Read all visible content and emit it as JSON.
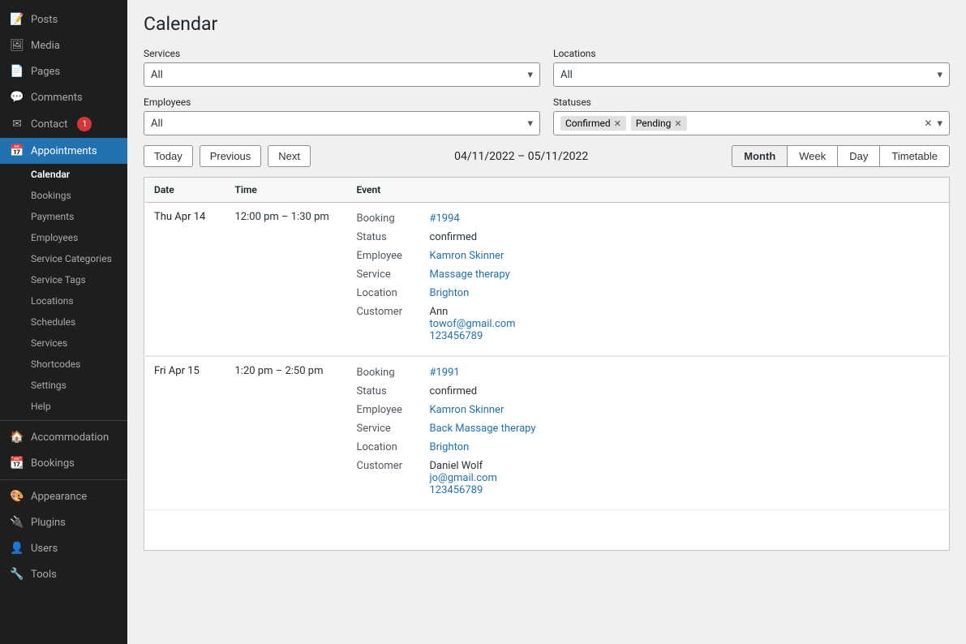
{
  "sidebar": {
    "items": [
      {
        "id": "posts",
        "icon": "📝",
        "label": "Posts"
      },
      {
        "id": "media",
        "icon": "🖼",
        "label": "Media"
      },
      {
        "id": "pages",
        "icon": "📄",
        "label": "Pages"
      },
      {
        "id": "comments",
        "icon": "💬",
        "label": "Comments"
      },
      {
        "id": "contact",
        "icon": "✉",
        "label": "Contact",
        "badge": "1"
      },
      {
        "id": "appointments",
        "icon": "📅",
        "label": "Appointments",
        "active": true
      }
    ],
    "appointments_sub": [
      {
        "id": "calendar",
        "label": "Calendar",
        "active": true
      },
      {
        "id": "bookings",
        "label": "Bookings"
      },
      {
        "id": "payments",
        "label": "Payments"
      },
      {
        "id": "employees",
        "label": "Employees"
      },
      {
        "id": "service-categories",
        "label": "Service Categories"
      },
      {
        "id": "service-tags",
        "label": "Service Tags"
      },
      {
        "id": "locations",
        "label": "Locations"
      },
      {
        "id": "schedules",
        "label": "Schedules"
      },
      {
        "id": "services",
        "label": "Services"
      },
      {
        "id": "shortcodes",
        "label": "Shortcodes"
      },
      {
        "id": "settings",
        "label": "Settings"
      },
      {
        "id": "help",
        "label": "Help"
      }
    ],
    "bottom_items": [
      {
        "id": "accommodation",
        "icon": "🏠",
        "label": "Accommodation"
      },
      {
        "id": "bookings2",
        "icon": "📆",
        "label": "Bookings"
      },
      {
        "id": "appearance",
        "icon": "🎨",
        "label": "Appearance"
      },
      {
        "id": "plugins",
        "icon": "🔌",
        "label": "Plugins"
      },
      {
        "id": "users",
        "icon": "👤",
        "label": "Users"
      },
      {
        "id": "tools",
        "icon": "🔧",
        "label": "Tools"
      }
    ]
  },
  "page": {
    "title": "Calendar"
  },
  "filters": {
    "services_label": "Services",
    "services_value": "All",
    "locations_label": "Locations",
    "locations_value": "All",
    "employees_label": "Employees",
    "employees_value": "All",
    "statuses_label": "Statuses",
    "statuses_tags": [
      {
        "label": "Confirmed"
      },
      {
        "label": "Pending"
      }
    ]
  },
  "navigation": {
    "today_label": "Today",
    "previous_label": "Previous",
    "next_label": "Next",
    "date_range": "04/11/2022 – 05/11/2022",
    "views": [
      {
        "id": "month",
        "label": "Month",
        "active": true
      },
      {
        "id": "week",
        "label": "Week"
      },
      {
        "id": "day",
        "label": "Day"
      },
      {
        "id": "timetable",
        "label": "Timetable"
      }
    ]
  },
  "table": {
    "headers": [
      {
        "id": "date",
        "label": "Date"
      },
      {
        "id": "time",
        "label": "Time"
      },
      {
        "id": "event",
        "label": "Event"
      }
    ],
    "rows": [
      {
        "date": "Thu Apr 14",
        "time": "12:00 pm – 1:30 pm",
        "booking_label": "Booking",
        "booking_value": "#1994",
        "booking_link": "#",
        "status_label": "Status",
        "status_value": "confirmed",
        "employee_label": "Employee",
        "employee_value": "Kamron Skinner",
        "employee_link": "#",
        "service_label": "Service",
        "service_value": "Massage therapy",
        "service_link": "#",
        "location_label": "Location",
        "location_value": "Brighton",
        "location_link": "#",
        "customer_label": "Customer",
        "customer_name": "Ann",
        "customer_email": "towof@gmail.com",
        "customer_phone": "123456789"
      },
      {
        "date": "Fri Apr 15",
        "time": "1:20 pm – 2:50 pm",
        "booking_label": "Booking",
        "booking_value": "#1991",
        "booking_link": "#",
        "status_label": "Status",
        "status_value": "confirmed",
        "employee_label": "Employee",
        "employee_value": "Kamron Skinner",
        "employee_link": "#",
        "service_label": "Service",
        "service_value": "Back Massage therapy",
        "service_link": "#",
        "location_label": "Location",
        "location_value": "Brighton",
        "location_link": "#",
        "customer_label": "Customer",
        "customer_name": "Daniel Wolf",
        "customer_email": "jo@gmail.com",
        "customer_phone": "123456789"
      }
    ]
  }
}
